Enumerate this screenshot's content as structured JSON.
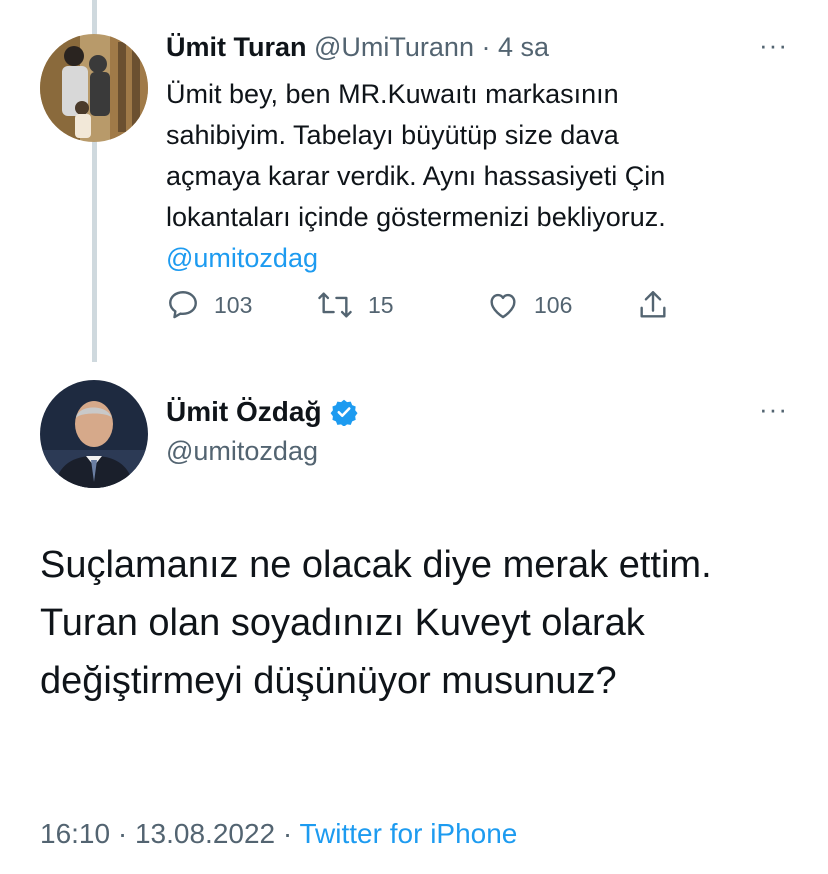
{
  "reply": {
    "author_name": "Ümit Turan",
    "author_handle": "@UmiTurann",
    "separator": "·",
    "time_ago": "4 sa",
    "more_label": "···",
    "text_lines": [
      "Ümit bey, ben MR.Kuwaıtı markasının",
      "sahibiyim. Tabelayı büyütüp size dava",
      "açmaya karar verdik. Aynı hassasiyeti Çin",
      "lokantaları içinde göstermenizi bekliyoruz."
    ],
    "mention": "@umitozdag",
    "actions": {
      "reply_count": "103",
      "retweet_count": "15",
      "like_count": "106"
    }
  },
  "tweet": {
    "author_name": "Ümit Özdağ",
    "author_handle": "@umitozdag",
    "verified": true,
    "more_label": "···",
    "text": "Suçlamanız ne olacak diye merak ettim. Turan olan soyadınızı Kuveyt olarak değiştirmeyi düşünüyor musunuz?",
    "time": "16:10",
    "separator": "·",
    "date": "13.08.2022",
    "separator2": "·",
    "source": "Twitter for iPhone"
  },
  "colors": {
    "accent": "#1d9bf0",
    "secondary_text": "#536471",
    "thread_line": "#cfd9de"
  },
  "icons": [
    "reply-icon",
    "retweet-icon",
    "like-icon",
    "share-icon",
    "verified-badge-icon",
    "more-icon"
  ]
}
